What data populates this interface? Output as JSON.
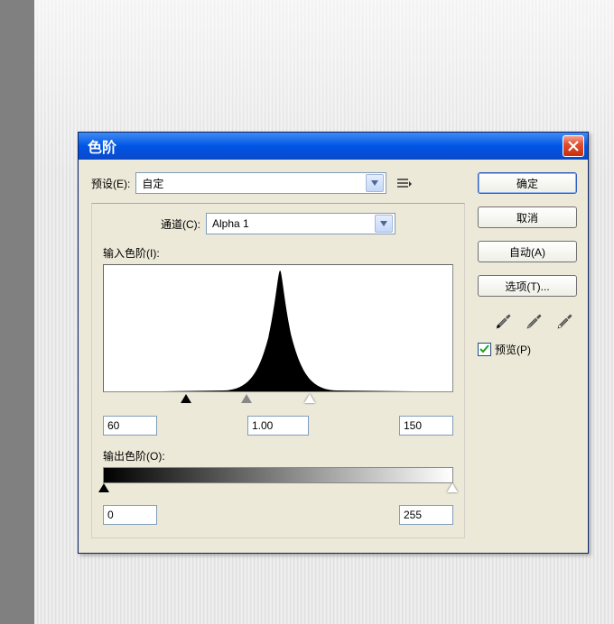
{
  "dialog": {
    "title": "色阶",
    "preset_label": "预设(E):",
    "preset_value": "自定",
    "channel_label": "通道(C):",
    "channel_value": "Alpha 1",
    "input_levels_label": "输入色阶(I):",
    "output_levels_label": "输出色阶(O):",
    "input_black": "60",
    "input_gamma": "1.00",
    "input_white": "150",
    "output_black": "0",
    "output_white": "255"
  },
  "buttons": {
    "ok": "确定",
    "cancel": "取消",
    "auto": "自动(A)",
    "options": "选项(T)..."
  },
  "preview": {
    "label": "预览(P)",
    "checked": true
  },
  "chart_data": {
    "type": "histogram",
    "title": "",
    "xlim": [
      0,
      255
    ],
    "ylabel": "",
    "shape": "gaussian",
    "peak_center": 128,
    "approx_black_point": 60,
    "approx_white_point": 150,
    "gamma": 1.0
  }
}
